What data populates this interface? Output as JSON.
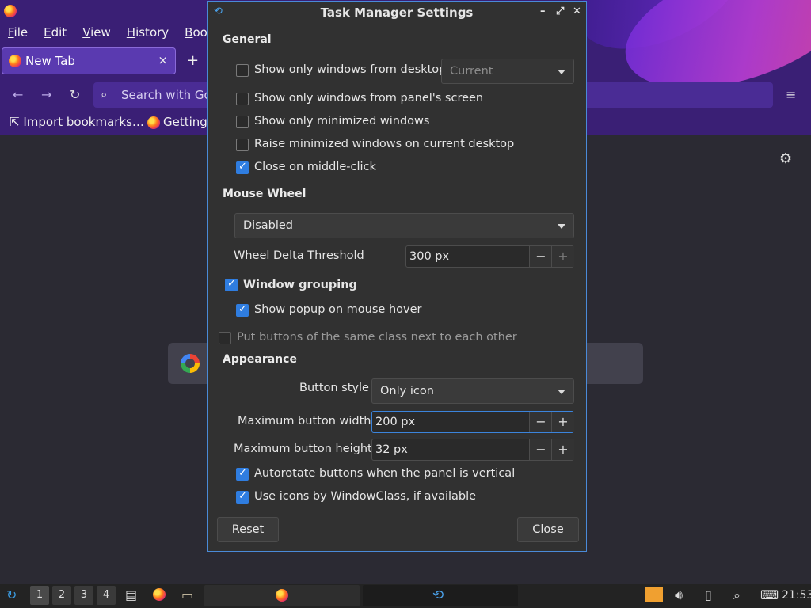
{
  "firefox": {
    "menubar": [
      "File",
      "Edit",
      "View",
      "History",
      "Boo"
    ],
    "tab_label": "New Tab",
    "tab_close": "×",
    "new_tab": "+",
    "url_placeholder": "Search with Goo",
    "bookmarks": [
      "Import bookmarks…",
      "Getting"
    ],
    "menu_icon": "≡",
    "gear_icon": "⚙"
  },
  "dialog": {
    "title": "Task Manager Settings",
    "window_buttons": {
      "minimize": "–",
      "maximize": "⤢",
      "close": "✕"
    },
    "general": {
      "heading": "General",
      "show_only_desktop": {
        "label": "Show only windows from desktop",
        "checked": false
      },
      "desktop_combo": "Current",
      "show_only_panel_screen": {
        "label": "Show only windows from panel's screen",
        "checked": false
      },
      "show_only_minimized": {
        "label": "Show only minimized windows",
        "checked": false
      },
      "raise_minimized": {
        "label": "Raise minimized windows on current desktop",
        "checked": false
      },
      "close_middle_click": {
        "label": "Close on middle-click",
        "checked": true
      }
    },
    "mouse_wheel": {
      "heading": "Mouse Wheel",
      "mode": "Disabled",
      "threshold_label": "Wheel Delta Threshold",
      "threshold_value": "300 px"
    },
    "grouping": {
      "window_grouping": {
        "label": "Window grouping",
        "checked": true
      },
      "show_popup": {
        "label": "Show popup on mouse hover",
        "checked": true
      },
      "same_class": {
        "label": "Put buttons of the same class next to each other",
        "checked": false
      }
    },
    "appearance": {
      "heading": "Appearance",
      "button_style_label": "Button style",
      "button_style_value": "Only icon",
      "max_width_label": "Maximum button width",
      "max_width_value": "200 px",
      "max_height_label": "Maximum button height",
      "max_height_value": "32 px",
      "autorotate": {
        "label": "Autorotate buttons when the panel is vertical",
        "checked": true
      },
      "use_icons": {
        "label": "Use icons by WindowClass, if available",
        "checked": true
      }
    },
    "buttons": {
      "reset": "Reset",
      "close": "Close"
    },
    "spin_minus": "−",
    "spin_plus": "+"
  },
  "taskbar": {
    "workspaces": [
      "1",
      "2",
      "3",
      "4"
    ],
    "clock": "21:53"
  },
  "colors": {
    "accent": "#2f7de0",
    "dialog_bg": "#313131",
    "firefox_header": "#3a1f75"
  }
}
